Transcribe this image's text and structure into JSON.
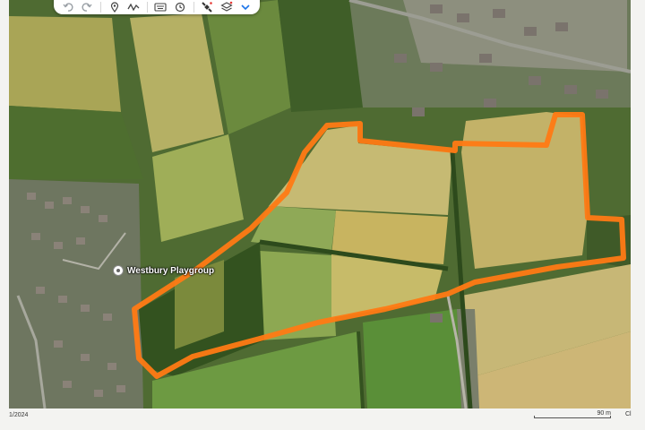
{
  "toolbar": {
    "buttons": [
      {
        "icon": "undo-icon"
      },
      {
        "icon": "redo-icon"
      },
      {
        "icon": "placemark-icon"
      },
      {
        "icon": "path-icon"
      },
      {
        "icon": "keyboard-icon"
      },
      {
        "icon": "history-icon"
      },
      {
        "icon": "satellite-icon"
      },
      {
        "icon": "layers-icon"
      },
      {
        "icon": "chevron-down-icon"
      }
    ]
  },
  "map": {
    "place_label": "Westbury Playgroup",
    "outline_color": "#ff7a14"
  },
  "footer": {
    "date_fragment": "1/2024",
    "scale_label": "90 m",
    "corner_fragment": "Cl"
  }
}
